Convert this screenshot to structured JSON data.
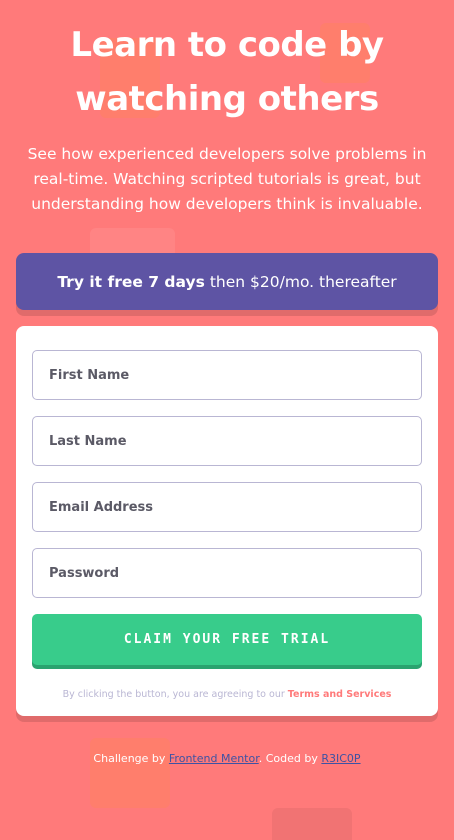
{
  "hero": {
    "title_line1": "Learn to code by",
    "title_line2": "watching others",
    "description": "See how experienced developers solve problems in real-time. Watching scripted tutorials is great, but understanding how developers think is invaluable."
  },
  "offer": {
    "bold": "Try it free 7 days",
    "rest": "then $20/mo. thereafter"
  },
  "form": {
    "first_name_placeholder": "First Name",
    "last_name_placeholder": "Last Name",
    "email_placeholder": "Email Address",
    "password_placeholder": "Password",
    "submit_label": "CLAIM YOUR FREE TRIAL",
    "terms_prefix": "By clicking the button, you are agreeing to our",
    "terms_link": "Terms and Services"
  },
  "footer": {
    "challenge_prefix": "Challenge by",
    "challenge_link": "Frontend Mentor",
    "coded_prefix": ". Coded by",
    "coded_link": "R3IC0P"
  },
  "colors": {
    "background": "#ff7a7a",
    "offer_bg": "#5e54a4",
    "submit_bg": "#38cc8b",
    "terms_link": "#ff7a7a"
  }
}
